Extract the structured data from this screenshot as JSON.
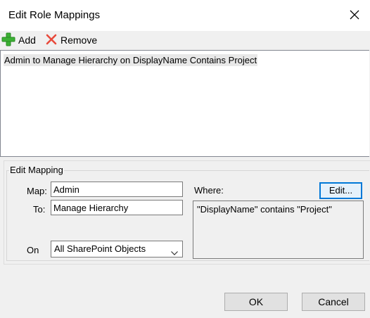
{
  "window": {
    "title": "Edit Role Mappings",
    "close_label": "×"
  },
  "toolbar": {
    "add_label": "Add",
    "remove_label": "Remove"
  },
  "mappings_list": {
    "items": [
      "Admin to Manage Hierarchy on DisplayName Contains Project"
    ]
  },
  "edit_mapping": {
    "group_title": "Edit Mapping",
    "map_label": "Map:",
    "map_value": "Admin",
    "to_label": "To:",
    "to_value": "Manage Hierarchy",
    "on_label": "On",
    "on_value": "All SharePoint Objects",
    "where_label": "Where:",
    "edit_button_label": "Edit...",
    "where_text": "\"DisplayName\" contains \"Project\""
  },
  "footer": {
    "ok_label": "OK",
    "cancel_label": "Cancel"
  },
  "colors": {
    "add_icon": "#3cb034",
    "remove_icon": "#e84a3b",
    "focus_border": "#0078d7",
    "dialog_background": "#f0f0f0"
  },
  "icons": {
    "add": "green-plus-icon",
    "remove": "red-x-icon",
    "close": "close-icon",
    "dropdown": "chevron-down-icon"
  }
}
